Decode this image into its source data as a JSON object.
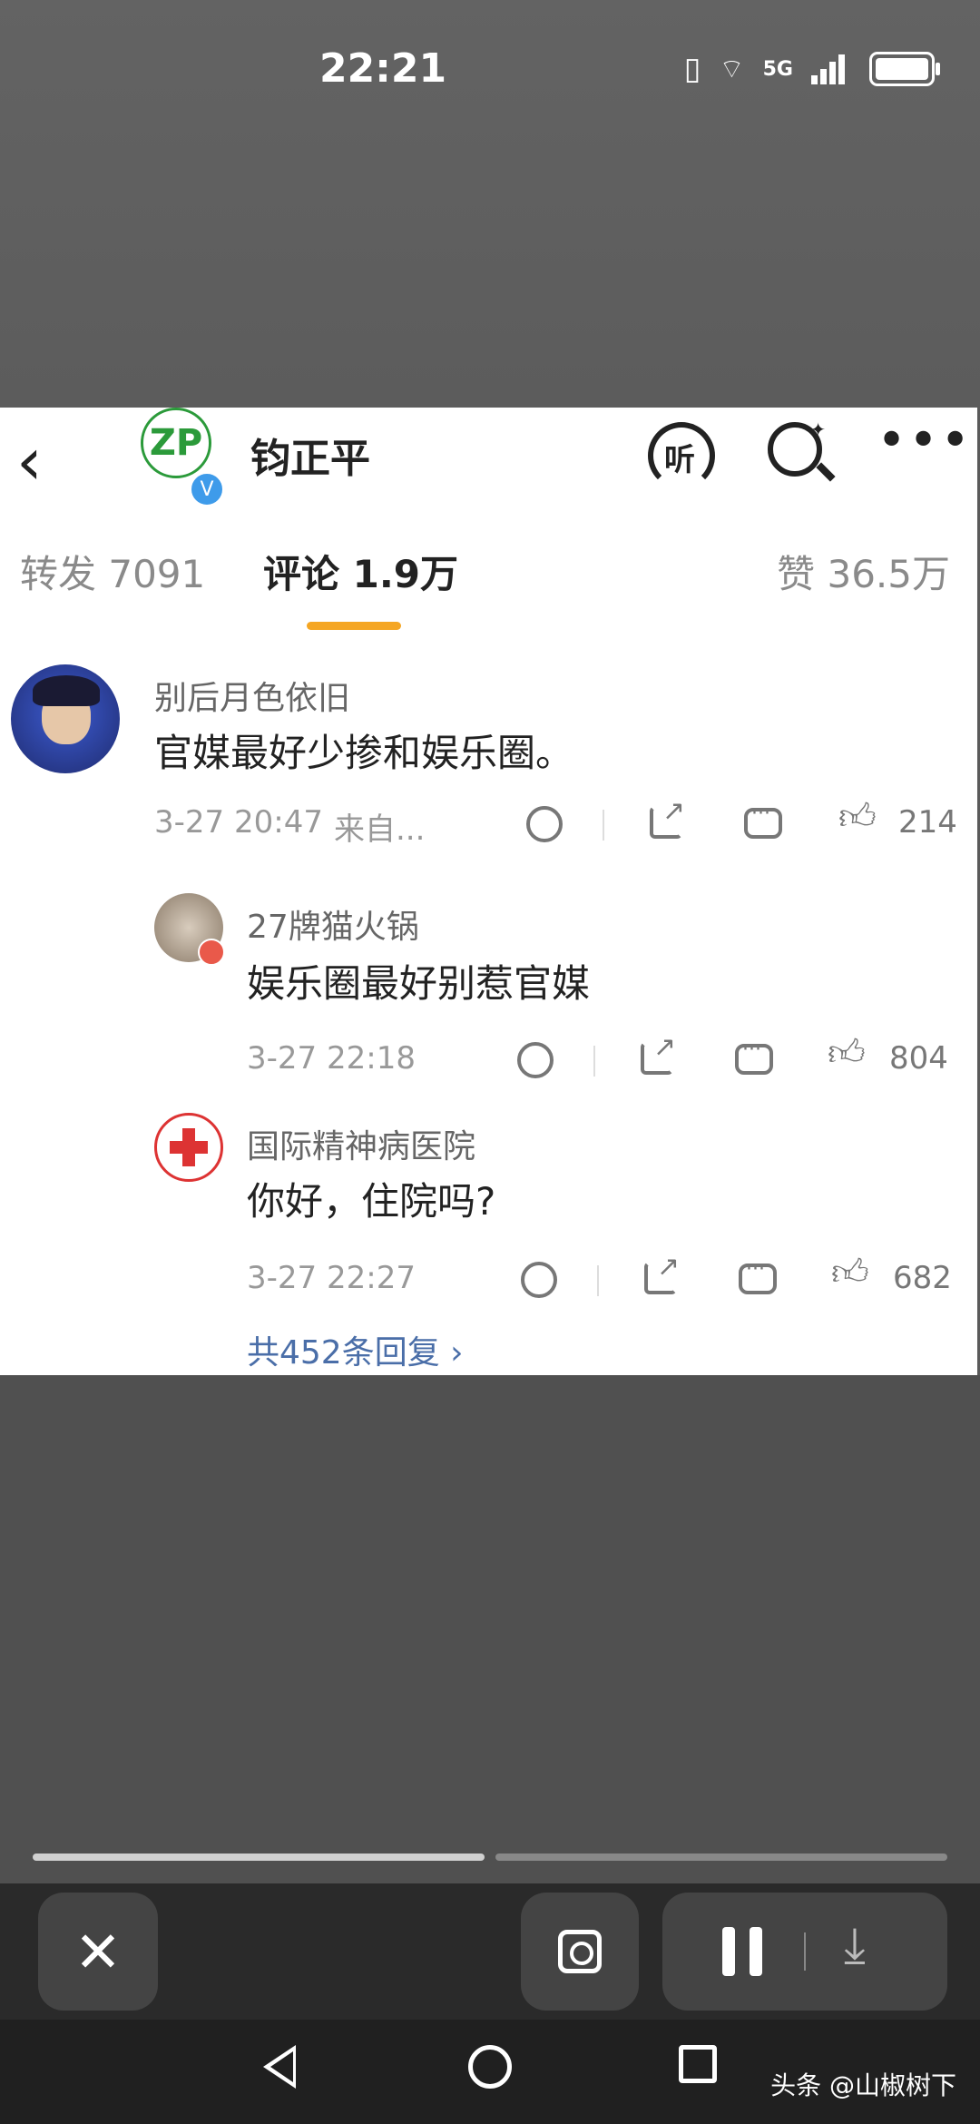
{
  "status": {
    "time": "22:21",
    "network_label": "5G",
    "wifi_badge": "6"
  },
  "header": {
    "account_name": "钧正平",
    "logo_letters": "ZP",
    "logo_sub": "钧正平",
    "verified": "V",
    "listen_label": "听"
  },
  "tabs": {
    "repost": "转发 7091",
    "comments": "评论 1.9万",
    "likes": "赞 36.5万"
  },
  "comments": [
    {
      "name": "别后月色依旧",
      "text": "官媒最好少掺和娱乐圈。",
      "time": "3-27 20:47",
      "source": "来自...",
      "likes": "214"
    },
    {
      "name": "27牌猫火锅",
      "text": "娱乐圈最好别惹官媒",
      "time": "3-27 22:18",
      "likes": "804"
    },
    {
      "name": "国际精神病医院",
      "text": "你好，住院吗?",
      "time": "3-27 22:27",
      "likes": "682"
    }
  ],
  "reply_link": "共452条回复 ›",
  "watermark": "头条 @山椒树下",
  "icons": {
    "back": "chevron-left-icon",
    "search": "search-icon",
    "more": "more-icon",
    "dislike": "dislike-face-icon",
    "share": "share-icon",
    "comment": "comment-icon",
    "like": "thumbs-up-icon"
  }
}
